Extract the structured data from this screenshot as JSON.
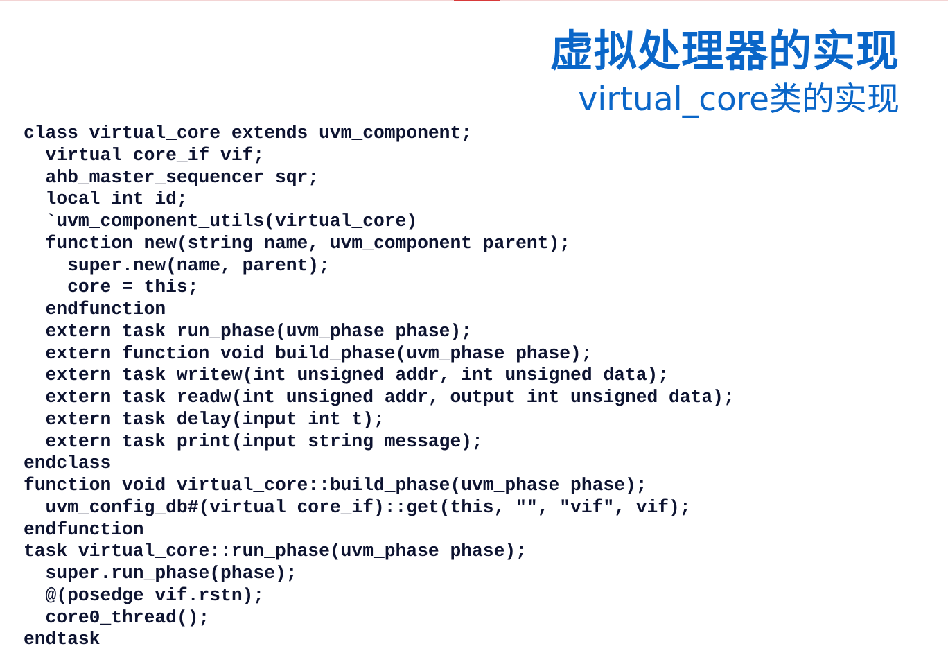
{
  "slide": {
    "title": "虚拟处理器的实现",
    "subtitle": "virtual_core类的实现",
    "accent_color": "#0a66c8",
    "top_bar_color": "#d83a3a"
  },
  "code_lines": [
    "class virtual_core extends uvm_component;",
    "  virtual core_if vif;",
    "  ahb_master_sequencer sqr;",
    "  local int id;",
    "  `uvm_component_utils(virtual_core)",
    "  function new(string name, uvm_component parent);",
    "    super.new(name, parent);",
    "    core = this;",
    "  endfunction",
    "  extern task run_phase(uvm_phase phase);",
    "  extern function void build_phase(uvm_phase phase);",
    "  extern task writew(int unsigned addr, int unsigned data);",
    "  extern task readw(int unsigned addr, output int unsigned data);",
    "  extern task delay(input int t);",
    "  extern task print(input string message);",
    "endclass",
    "function void virtual_core::build_phase(uvm_phase phase);",
    "  uvm_config_db#(virtual core_if)::get(this, \"\", \"vif\", vif);",
    "endfunction",
    "task virtual_core::run_phase(uvm_phase phase);",
    "  super.run_phase(phase);",
    "  @(posedge vif.rstn);",
    "  core0_thread();",
    "endtask"
  ]
}
